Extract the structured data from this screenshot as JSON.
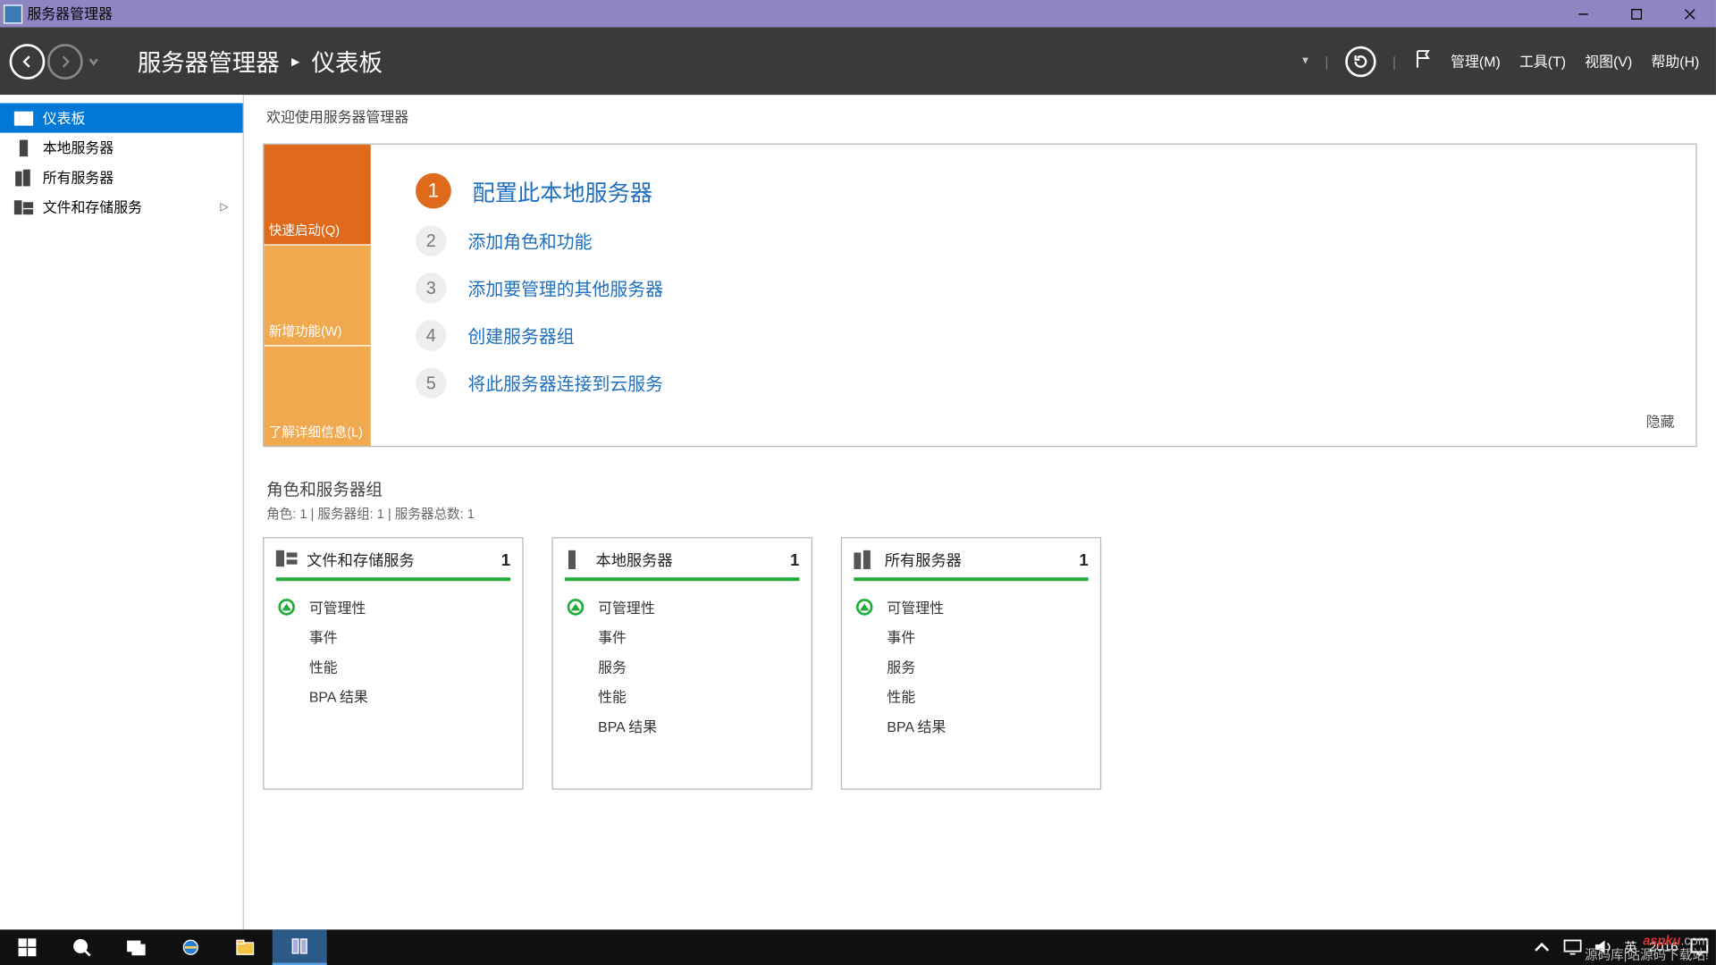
{
  "window": {
    "title": "服务器管理器"
  },
  "breadcrumb": {
    "app": "服务器管理器",
    "page": "仪表板"
  },
  "menu": {
    "manage": "管理(M)",
    "tools": "工具(T)",
    "view": "视图(V)",
    "help": "帮助(H)"
  },
  "sidebar": {
    "items": [
      {
        "label": "仪表板"
      },
      {
        "label": "本地服务器"
      },
      {
        "label": "所有服务器"
      },
      {
        "label": "文件和存储服务"
      }
    ]
  },
  "welcome": {
    "title": "欢迎使用服务器管理器",
    "tiles": {
      "quick": "快速启动(Q)",
      "whatsnew": "新增功能(W)",
      "learn": "了解详细信息(L)"
    },
    "steps": [
      {
        "n": "1",
        "label": "配置此本地服务器"
      },
      {
        "n": "2",
        "label": "添加角色和功能"
      },
      {
        "n": "3",
        "label": "添加要管理的其他服务器"
      },
      {
        "n": "4",
        "label": "创建服务器组"
      },
      {
        "n": "5",
        "label": "将此服务器连接到云服务"
      }
    ],
    "hide": "隐藏"
  },
  "roles": {
    "title": "角色和服务器组",
    "subtitle": "角色: 1 | 服务器组: 1 | 服务器总数: 1",
    "cards": [
      {
        "title": "文件和存储服务",
        "count": "1",
        "rows": [
          "可管理性",
          "事件",
          "性能",
          "BPA 结果"
        ]
      },
      {
        "title": "本地服务器",
        "count": "1",
        "rows": [
          "可管理性",
          "事件",
          "服务",
          "性能",
          "BPA 结果"
        ]
      },
      {
        "title": "所有服务器",
        "count": "1",
        "rows": [
          "可管理性",
          "事件",
          "服务",
          "性能",
          "BPA 结果"
        ]
      }
    ]
  },
  "taskbar": {
    "ime": "英",
    "date": "2016",
    "watermark_site": "aspku",
    "watermark_ext": ".com",
    "watermark_sub": "源码库|站源码下载站!"
  }
}
